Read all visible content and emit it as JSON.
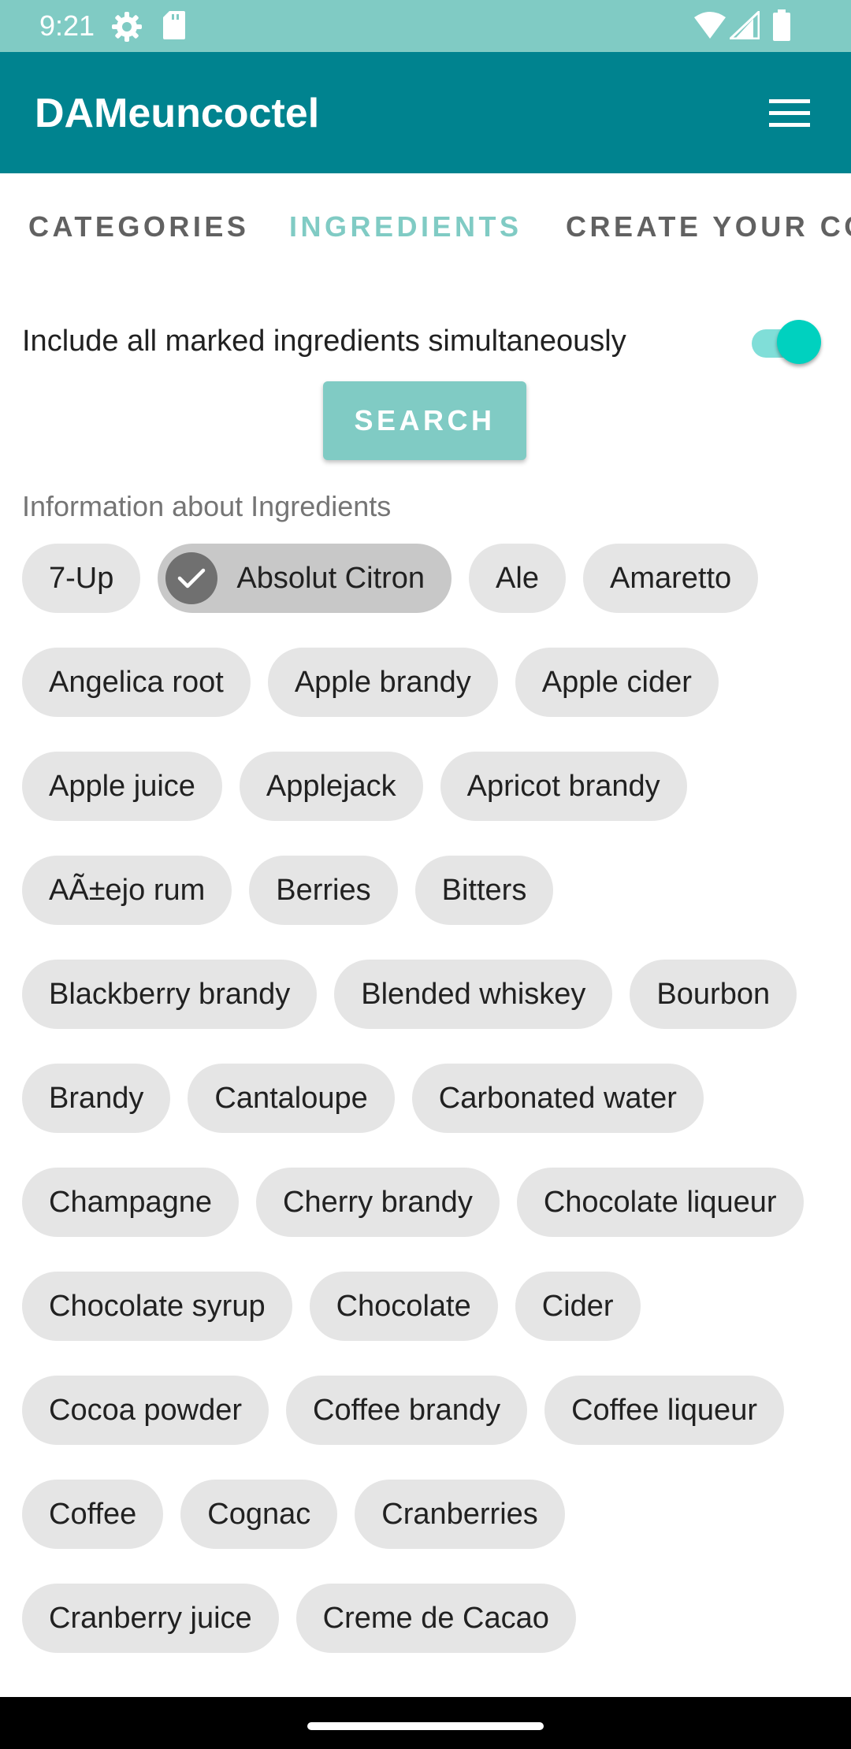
{
  "status_bar": {
    "time": "9:21",
    "left_icons": [
      "gear-icon",
      "sd-card-icon"
    ],
    "right_icons": [
      "wifi-icon",
      "signal-icon",
      "battery-icon"
    ]
  },
  "app_bar": {
    "title": "DAMeuncoctel",
    "menu_icon": "hamburger-menu-icon"
  },
  "tabs": [
    {
      "label": "CATEGORIES",
      "active": false
    },
    {
      "label": "INGREDIENTS",
      "active": true
    },
    {
      "label": "CREATE YOUR CO",
      "active": false
    }
  ],
  "filter": {
    "toggle_label": "Include all marked ingredients simultaneously",
    "toggle_on": true,
    "search_label": "SEARCH"
  },
  "section_label": "Information about Ingredients",
  "chip_rows": [
    [
      "7-Up",
      "Absolut Citron",
      "Ale",
      "Amaretto"
    ],
    [
      "Angelica root",
      "Apple brandy",
      "Apple cider"
    ],
    [
      "Apple juice",
      "Applejack",
      "Apricot brandy"
    ],
    [
      "AÃ±ejo rum",
      "Berries",
      "Bitters"
    ],
    [
      "Blackberry brandy",
      "Blended whiskey",
      "Bourbon"
    ],
    [
      "Brandy",
      "Cantaloupe",
      "Carbonated water"
    ],
    [
      "Champagne",
      "Cherry brandy",
      "Chocolate liqueur"
    ],
    [
      "Chocolate syrup",
      "Chocolate",
      "Cider"
    ],
    [
      "Cocoa powder",
      "Coffee brandy",
      "Coffee liqueur"
    ],
    [
      "Coffee",
      "Cognac",
      "Cranberries"
    ],
    [
      "Cranberry juice",
      "Creme de Cacao"
    ]
  ],
  "selected_chips": [
    "Absolut Citron"
  ],
  "colors": {
    "status_bar": "#80CBC4",
    "app_bar": "#00838F",
    "accent": "#80CBC4",
    "switch_thumb": "#00D1BF",
    "chip": "#E5E5E5",
    "chip_selected": "#C8C8C8"
  }
}
